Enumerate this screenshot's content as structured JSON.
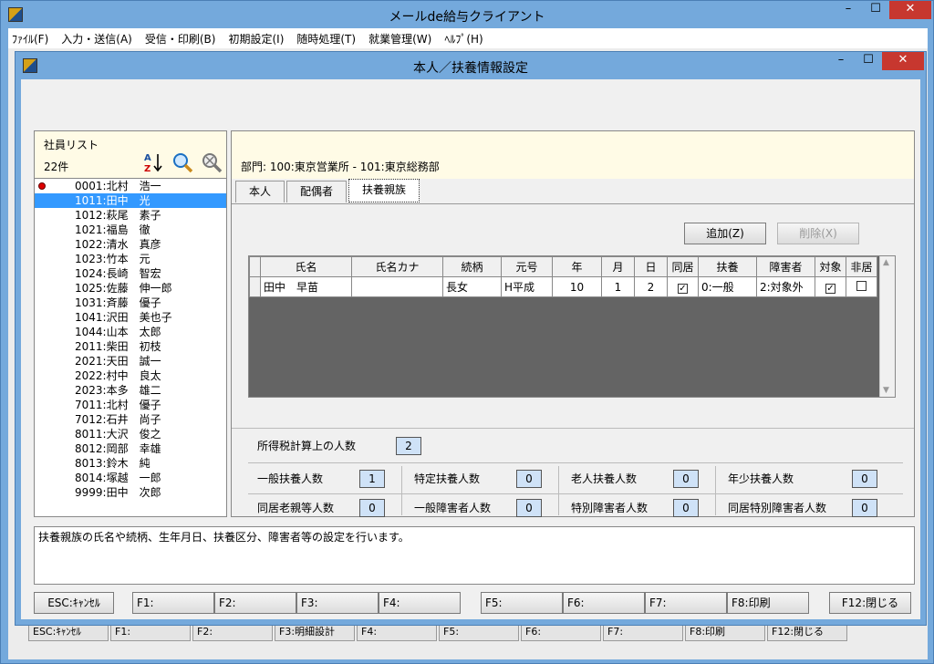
{
  "main_window": {
    "title": "メールde給与クライアント",
    "controls": {
      "minimize": "–",
      "maximize": "☐",
      "close": "✕"
    },
    "menu": [
      "ﾌｧｲﾙ(F)",
      "入力・送信(A)",
      "受信・印刷(B)",
      "初期設定(I)",
      "随時処理(T)",
      "就業管理(W)",
      "ﾍﾙﾌﾟ(H)"
    ],
    "background_fkeys": [
      "ESC:ｷｬﾝｾﾙ",
      "F1:",
      "F2:",
      "F3:明細設計",
      "F4:",
      "F5:",
      "F6:",
      "F7:",
      "F8:印刷",
      "F12:閉じる"
    ]
  },
  "dialog": {
    "title": "本人／扶養情報設定",
    "controls": {
      "minimize": "–",
      "maximize": "☐",
      "close": "✕"
    }
  },
  "employee_list": {
    "title": "社員リスト",
    "count": "22件",
    "icons": [
      "sort-az-icon",
      "search-icon",
      "search-clear-icon"
    ],
    "items": [
      {
        "label": "0001:北村　浩一",
        "marked": true,
        "selected": false
      },
      {
        "label": "1011:田中　光",
        "marked": false,
        "selected": true
      },
      {
        "label": "1012:萩尾　素子",
        "marked": false,
        "selected": false
      },
      {
        "label": "1021:福島　徹",
        "marked": false,
        "selected": false
      },
      {
        "label": "1022:清水　真彦",
        "marked": false,
        "selected": false
      },
      {
        "label": "1023:竹本　元",
        "marked": false,
        "selected": false
      },
      {
        "label": "1024:長崎　智宏",
        "marked": false,
        "selected": false
      },
      {
        "label": "1025:佐藤　伸一郎",
        "marked": false,
        "selected": false
      },
      {
        "label": "1031:斉藤　優子",
        "marked": false,
        "selected": false
      },
      {
        "label": "1041:沢田　美也子",
        "marked": false,
        "selected": false
      },
      {
        "label": "1044:山本　太郎",
        "marked": false,
        "selected": false
      },
      {
        "label": "2011:柴田　初枝",
        "marked": false,
        "selected": false
      },
      {
        "label": "2021:天田　誠一",
        "marked": false,
        "selected": false
      },
      {
        "label": "2022:村中　良太",
        "marked": false,
        "selected": false
      },
      {
        "label": "2023:本多　雄二",
        "marked": false,
        "selected": false
      },
      {
        "label": "7011:北村　優子",
        "marked": false,
        "selected": false
      },
      {
        "label": "7012:石井　尚子",
        "marked": false,
        "selected": false
      },
      {
        "label": "8011:大沢　俊之",
        "marked": false,
        "selected": false
      },
      {
        "label": "8012:岡部　幸雄",
        "marked": false,
        "selected": false
      },
      {
        "label": "8013:鈴木　純",
        "marked": false,
        "selected": false
      },
      {
        "label": "8014:塚越　一郎",
        "marked": false,
        "selected": false
      },
      {
        "label": "9999:田中　次郎",
        "marked": false,
        "selected": false
      }
    ]
  },
  "department": "部門:  100:東京営業所 - 101:東京総務部",
  "tabs": [
    "本人",
    "配偶者",
    "扶養親族"
  ],
  "active_tab": 2,
  "buttons": {
    "add": "追加(Z)",
    "delete": "削除(X)"
  },
  "grid": {
    "columns": [
      "氏名",
      "氏名カナ",
      "続柄",
      "元号",
      "年",
      "月",
      "日",
      "同居",
      "扶養",
      "障害者",
      "対象",
      "非居"
    ],
    "rows": [
      {
        "name": "田中　早苗",
        "kana": "",
        "relation": "長女",
        "era": "H平成",
        "year": "10",
        "month": "1",
        "day": "2",
        "dokyo": true,
        "fuyo": "0:一般",
        "shogai": "2:対象外",
        "taisho": true,
        "hikyo": false
      }
    ]
  },
  "counts": {
    "tax_count_label": "所得税計算上の人数",
    "tax_count": "2",
    "items": [
      {
        "label": "一般扶養人数",
        "value": "1"
      },
      {
        "label": "特定扶養人数",
        "value": "0"
      },
      {
        "label": "老人扶養人数",
        "value": "0"
      },
      {
        "label": "年少扶養人数",
        "value": "0"
      },
      {
        "label": "同居老親等人数",
        "value": "0"
      },
      {
        "label": "一般障害者人数",
        "value": "0"
      },
      {
        "label": "特別障害者人数",
        "value": "0"
      },
      {
        "label": "同居特別障害者人数",
        "value": "0"
      }
    ]
  },
  "description": "扶養親族の氏名や続柄、生年月日、扶養区分、障害者等の設定を行います。",
  "fkeys": [
    "ESC:ｷｬﾝｾﾙ",
    "F1:",
    "F2:",
    "F3:",
    "F4:",
    "F5:",
    "F6:",
    "F7:",
    "F8:印刷",
    "F12:閉じる"
  ]
}
